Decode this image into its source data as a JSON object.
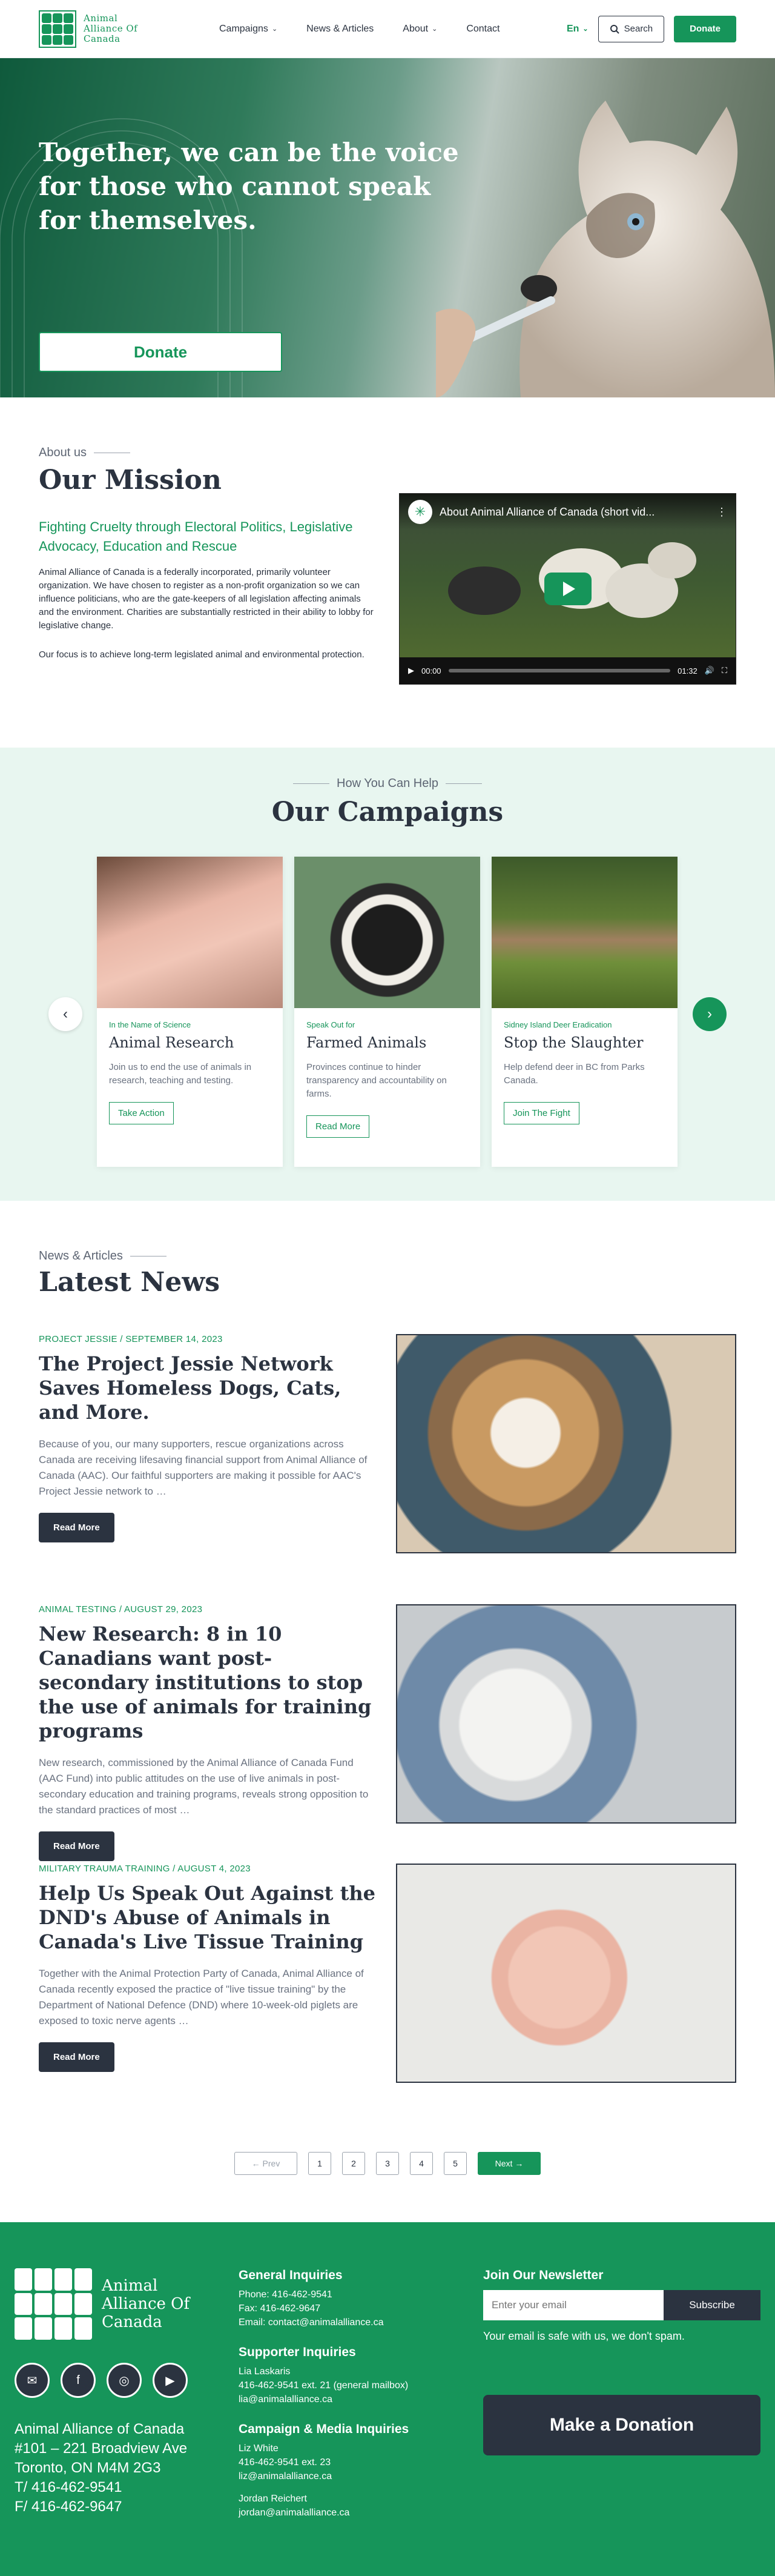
{
  "header": {
    "logo_text": "Animal Alliance Of Canada",
    "nav": [
      "Campaigns",
      "News & Articles",
      "About",
      "Contact"
    ],
    "lang": "En",
    "search_label": "Search",
    "donate_label": "Donate"
  },
  "hero": {
    "title": "Together, we can be the voice for those who cannot speak for themselves.",
    "donate_label": "Donate"
  },
  "mission": {
    "eyebrow": "About us",
    "title": "Our Mission",
    "subtitle": "Fighting Cruelty through Electoral Politics, Legislative Advocacy, Education and Rescue",
    "paragraph1": "Animal Alliance of Canada is a federally incorporated, primarily volunteer organization. We have chosen to register as a non-profit organization so we can influence politicians, who are the gate-keepers of all legislation affecting animals and the environment. Charities are substantially restricted in their ability to lobby for legislative change.",
    "paragraph2": "Our focus is to achieve long-term legislated animal and environmental protection.",
    "video": {
      "title": "About Animal Alliance of Canada (short vid...",
      "time_current": "00:00",
      "time_total": "01:32"
    }
  },
  "campaigns": {
    "eyebrow": "How You Can Help",
    "title": "Our Campaigns",
    "cards": [
      {
        "tag": "In the Name of Science",
        "title": "Animal Research",
        "text": "Join us to end the use of animals in research, teaching and testing.",
        "button": "Take Action"
      },
      {
        "tag": "Speak Out for",
        "title": "Farmed Animals",
        "text": "Provinces continue to hinder transparency and accountability on farms.",
        "button": "Read More"
      },
      {
        "tag": "Sidney Island Deer Eradication",
        "title": "Stop the Slaughter",
        "text": "Help defend deer in BC from Parks Canada.",
        "button": "Join The Fight"
      }
    ]
  },
  "news": {
    "eyebrow": "News & Articles",
    "title": "Latest News",
    "read_more": "Read More",
    "articles": [
      {
        "meta": "PROJECT JESSIE / SEPTEMBER 14, 2023",
        "title": "The Project Jessie Network Saves Homeless Dogs, Cats, and More.",
        "excerpt": "Because of you, our many supporters, rescue organizations across Canada are receiving lifesaving financial support from Animal Alliance of Canada (AAC). Our faithful supporters are making it possible for AAC's Project Jessie network to …"
      },
      {
        "meta": "ANIMAL TESTING / AUGUST 29, 2023",
        "title": "New Research: 8 in 10 Canadians want post-secondary institutions to stop the use of animals for training programs",
        "excerpt": "New research, commissioned by the Animal Alliance of Canada Fund (AAC Fund) into public attitudes on the use of live animals in post-secondary education and training programs, reveals strong opposition to the standard practices of most …"
      },
      {
        "meta": "MILITARY TRAUMA TRAINING / AUGUST 4, 2023",
        "title": "Help Us Speak Out Against the DND's Abuse of Animals in Canada's Live Tissue Training",
        "excerpt": "Together with the Animal Protection Party of Canada, Animal Alliance of Canada recently exposed the practice of \"live tissue training\" by the Department of National Defence (DND) where 10-week-old piglets are exposed to toxic nerve agents …"
      }
    ],
    "pagination": {
      "prev": "← Prev",
      "pages": [
        "1",
        "2",
        "3",
        "4",
        "5"
      ],
      "next": "Next →"
    }
  },
  "footer": {
    "logo_text": "Animal Alliance Of Canada",
    "address": [
      "Animal Alliance of Canada",
      "#101 – 221 Broadview Ave",
      "Toronto, ON M4M 2G3",
      "T/  416-462-9541",
      "F/  416-462-9647"
    ],
    "general": {
      "heading": "General Inquiries",
      "lines": [
        "Phone: 416-462-9541",
        "Fax: 416-462-9647",
        "Email: contact@animalalliance.ca"
      ]
    },
    "supporter": {
      "heading": "Supporter Inquiries",
      "lines": [
        "Lia Laskaris",
        "416-462-9541 ext. 21 (general mailbox)",
        "lia@animalalliance.ca"
      ]
    },
    "media": {
      "heading": "Campaign & Media Inquiries",
      "lines": [
        "Liz White",
        "416-462-9541 ext. 23",
        "liz@animalalliance.ca",
        "",
        "Jordan Reichert",
        "jordan@animalalliance.ca"
      ]
    },
    "newsletter": {
      "heading": "Join Our Newsletter",
      "placeholder": "Enter your email",
      "button": "Subscribe",
      "note": "Your email is safe with us, we don't spam."
    },
    "donation_label": "Make a Donation"
  },
  "colors": {
    "brand_green": "#16955a",
    "dark": "#2b3340",
    "mint": "#e8f6f0"
  },
  "icons": [
    "search-icon",
    "chevron-down-icon",
    "play-icon",
    "email-icon",
    "facebook-icon",
    "instagram-icon",
    "youtube-icon",
    "arrow-left-icon",
    "arrow-right-icon"
  ]
}
